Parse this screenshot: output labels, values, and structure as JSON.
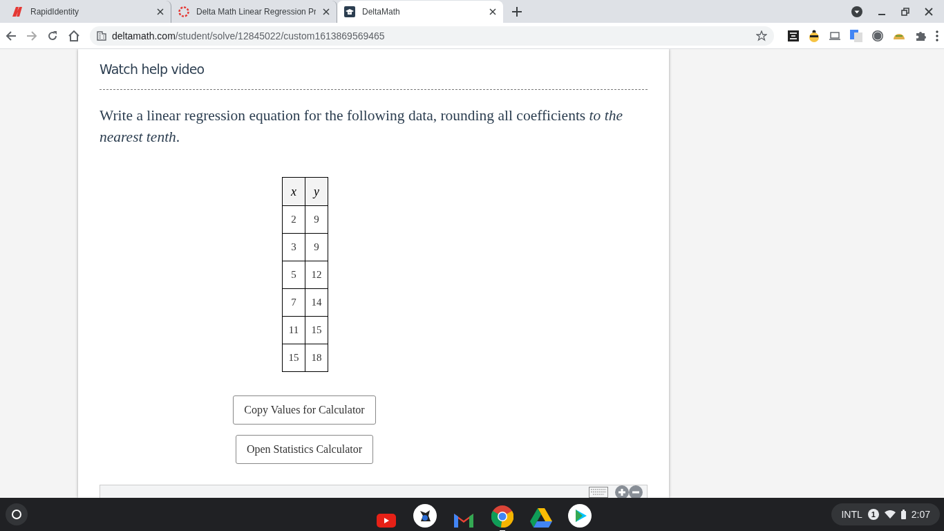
{
  "browser": {
    "tabs": [
      {
        "title": "RapidIdentity",
        "kind": "rapid",
        "selected": false
      },
      {
        "title": "Delta Math Linear Regression Pr",
        "kind": "ring",
        "selected": false
      },
      {
        "title": "DeltaMath",
        "kind": "delta",
        "selected": true
      }
    ],
    "url": {
      "host": "deltamath.com",
      "path": "/student/solve/12845022/custom1613869569465"
    }
  },
  "problem": {
    "help_link": "Watch help video",
    "prompt": "Write a linear regression equation for the following data, rounding all coefficients *to the nearest tenth*.",
    "table": {
      "columns": [
        "x",
        "y"
      ],
      "rows": [
        [
          "2",
          "9"
        ],
        [
          "3",
          "9"
        ],
        [
          "5",
          "12"
        ],
        [
          "7",
          "14"
        ],
        [
          "11",
          "15"
        ],
        [
          "15",
          "18"
        ]
      ]
    },
    "buttons": [
      "Copy Values for Calculator",
      "Open Statistics Calculator"
    ]
  },
  "taskbar": {
    "apps": [
      {
        "kind": "youtube"
      },
      {
        "kind": "penguin"
      },
      {
        "kind": "mail"
      },
      {
        "kind": "chrome",
        "selected": true
      },
      {
        "kind": "drive"
      },
      {
        "kind": "play"
      }
    ],
    "status": {
      "input": "INTL",
      "notifications": "1",
      "time": "2:07"
    }
  }
}
